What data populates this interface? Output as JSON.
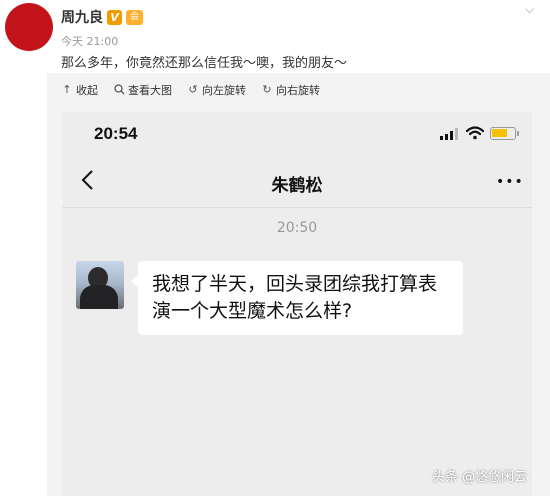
{
  "post": {
    "author": "周九良",
    "verified_badge": "V",
    "member_badge": "会",
    "time": "今天 21:00",
    "text": "那么多年，你竟然还那么信任我～噢，我的朋友～"
  },
  "toolbar": {
    "collapse": "收起",
    "view_large": "查看大图",
    "rotate_left": "向左旋转",
    "rotate_right": "向右旋转"
  },
  "chat": {
    "status_time": "20:54",
    "title": "朱鹤松",
    "more": "•••",
    "timestamp": "20:50",
    "message": "我想了半天，回头录团综我打算表演一个大型魔术怎么样?",
    "battery_level": 0.7
  },
  "watermark": "头条 @悠悠闲云",
  "colors": {
    "avatar_red": "#c4141b",
    "badge_orange": "#f39a00",
    "battery_yellow": "#f5c000"
  }
}
